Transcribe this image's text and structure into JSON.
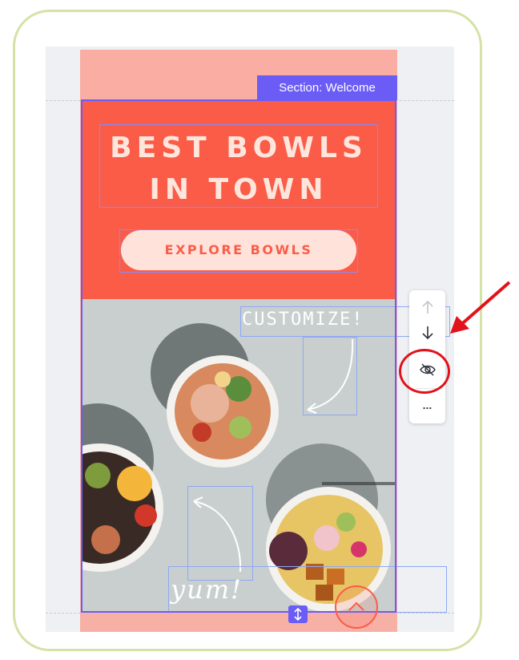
{
  "section_label": "Section: Welcome",
  "hero": {
    "title_line1": "BEST BOWLS",
    "title_line2": "IN TOWN",
    "cta_label": "EXPLORE BOWLS"
  },
  "photo": {
    "customize_text": "CUSTOMIZE!",
    "yum_text": "yum!"
  },
  "toolbar": {
    "move_up_icon": "arrow-up-icon",
    "move_down_icon": "arrow-down-icon",
    "hide_icon": "eye-off-icon",
    "more_icon": "more-icon",
    "more_label": "..."
  },
  "colors": {
    "accent": "#6b5cf6",
    "hero_bg": "#fb5c48",
    "page_pink": "#f7b0a6",
    "annotation_red": "#e2121b"
  }
}
